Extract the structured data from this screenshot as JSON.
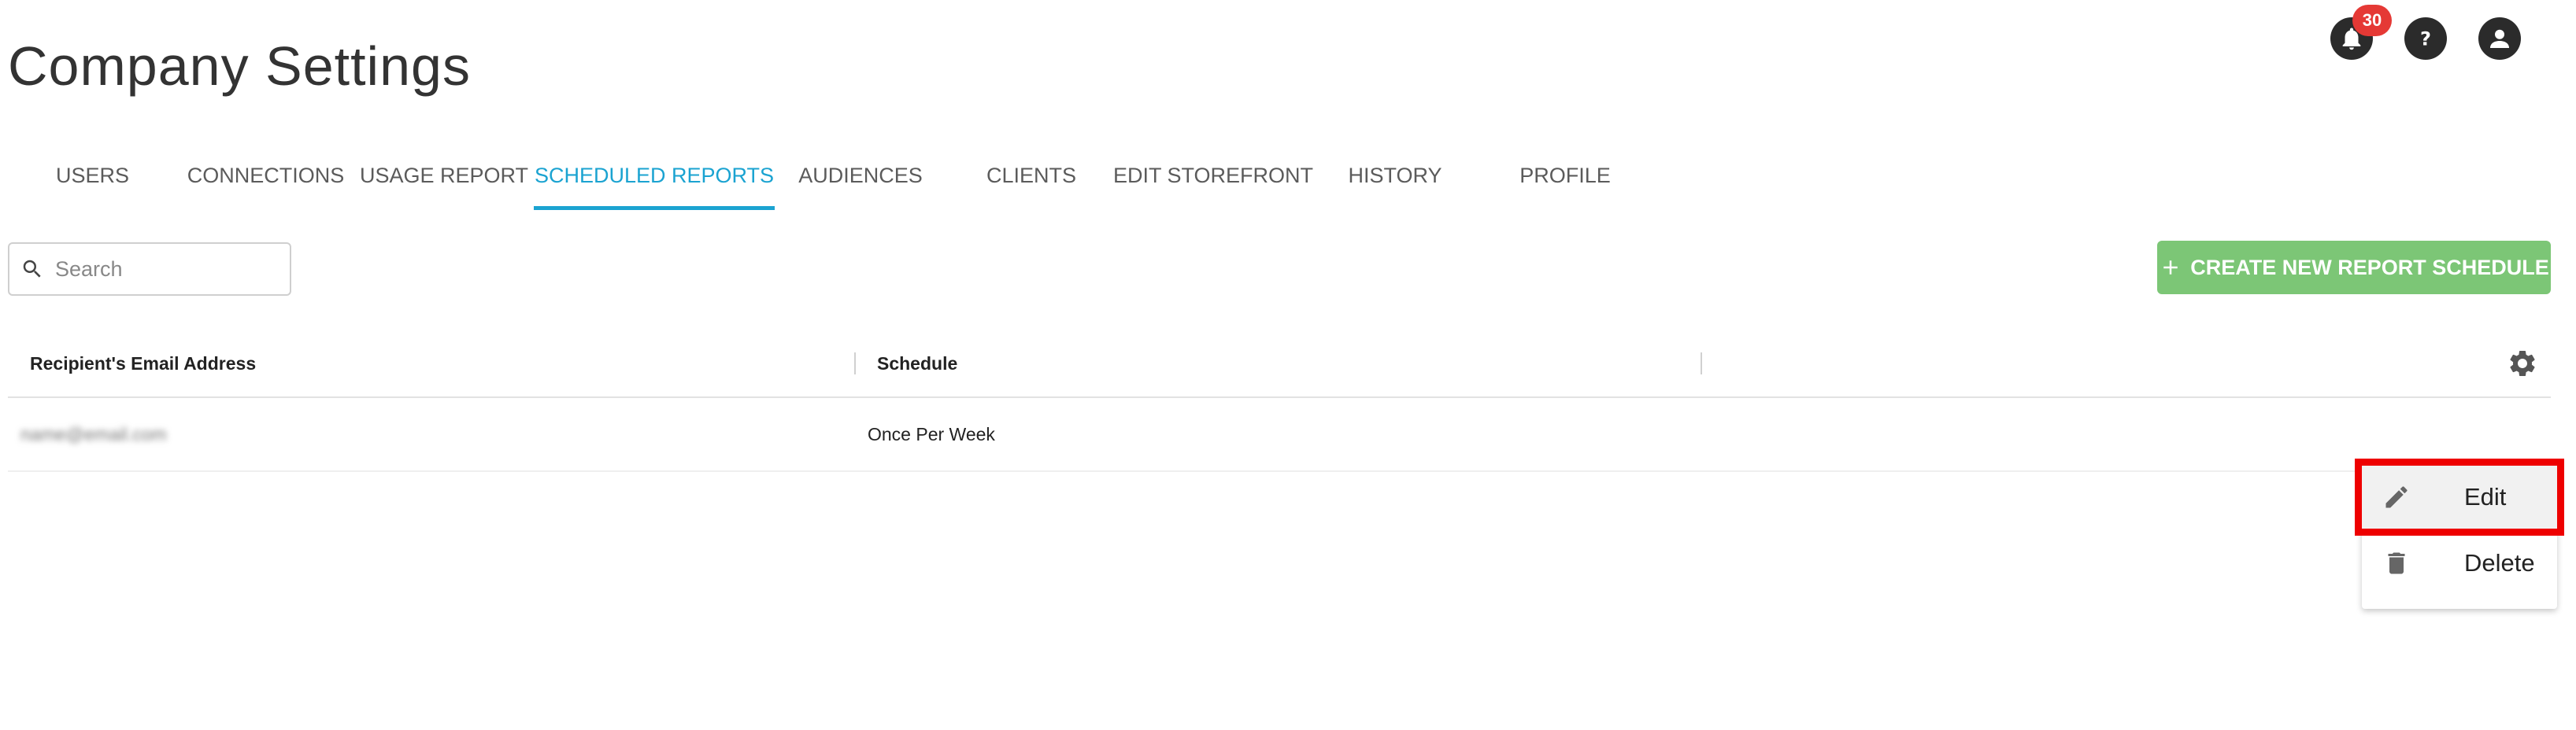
{
  "header": {
    "title": "Company Settings",
    "notification_count": "30"
  },
  "icons": {
    "notifications": "bell-icon",
    "help": "help-icon",
    "account": "account-icon",
    "search": "search-icon",
    "add": "plus-icon",
    "settings": "gear-icon",
    "edit": "pencil-icon",
    "delete": "trash-icon"
  },
  "tabs": [
    {
      "label": "USERS",
      "active": false
    },
    {
      "label": "CONNECTIONS",
      "active": false
    },
    {
      "label": "USAGE REPORT",
      "active": false
    },
    {
      "label": "SCHEDULED REPORTS",
      "active": true
    },
    {
      "label": "AUDIENCES",
      "active": false
    },
    {
      "label": "CLIENTS",
      "active": false
    },
    {
      "label": "EDIT STOREFRONT",
      "active": false
    },
    {
      "label": "HISTORY",
      "active": false
    },
    {
      "label": "PROFILE",
      "active": false
    }
  ],
  "search": {
    "placeholder": "Search",
    "value": ""
  },
  "actions": {
    "create_label": "CREATE NEW REPORT SCHEDULE"
  },
  "table": {
    "columns": [
      "Recipient's Email Address",
      "Schedule"
    ],
    "rows": [
      {
        "email": "name@email.com",
        "schedule": "Once Per Week"
      }
    ]
  },
  "context_menu": {
    "items": [
      {
        "label": "Edit",
        "highlighted": true
      },
      {
        "label": "Delete",
        "highlighted": false
      }
    ]
  },
  "colors": {
    "accent": "#1ba3d1",
    "primary_button": "#7cc676",
    "badge": "#e53935",
    "highlight_box": "#ee0000"
  }
}
